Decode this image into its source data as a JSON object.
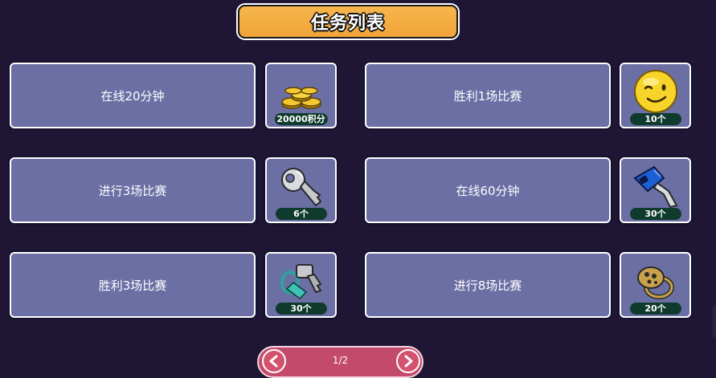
{
  "header": {
    "title": "任务列表"
  },
  "tasks": [
    {
      "name": "在线20分钟",
      "reward": {
        "icon": "gold-coins-icon",
        "qty": "20000积分"
      }
    },
    {
      "name": "胜利1场比赛",
      "reward": {
        "icon": "smiley-emoji-icon",
        "qty": "10个"
      }
    },
    {
      "name": "进行3场比赛",
      "reward": {
        "icon": "silver-key-icon",
        "qty": "6个"
      }
    },
    {
      "name": "在线60分钟",
      "reward": {
        "icon": "blue-hairdryer-icon",
        "qty": "30个"
      }
    },
    {
      "name": "胜利3场比赛",
      "reward": {
        "icon": "key-tag-icon",
        "qty": "30个"
      }
    },
    {
      "name": "进行8场比赛",
      "reward": {
        "icon": "gold-ring-icon",
        "qty": "20个"
      }
    }
  ],
  "pager": {
    "page": "1/2",
    "prev_icon": "arrow-left-icon",
    "next_icon": "arrow-right-icon"
  },
  "colors": {
    "background": "#1f1636",
    "card": "#6b6fa4",
    "banner": "#f7b64c",
    "pager": "#c34a6c",
    "badge": "#0f3b2e"
  }
}
